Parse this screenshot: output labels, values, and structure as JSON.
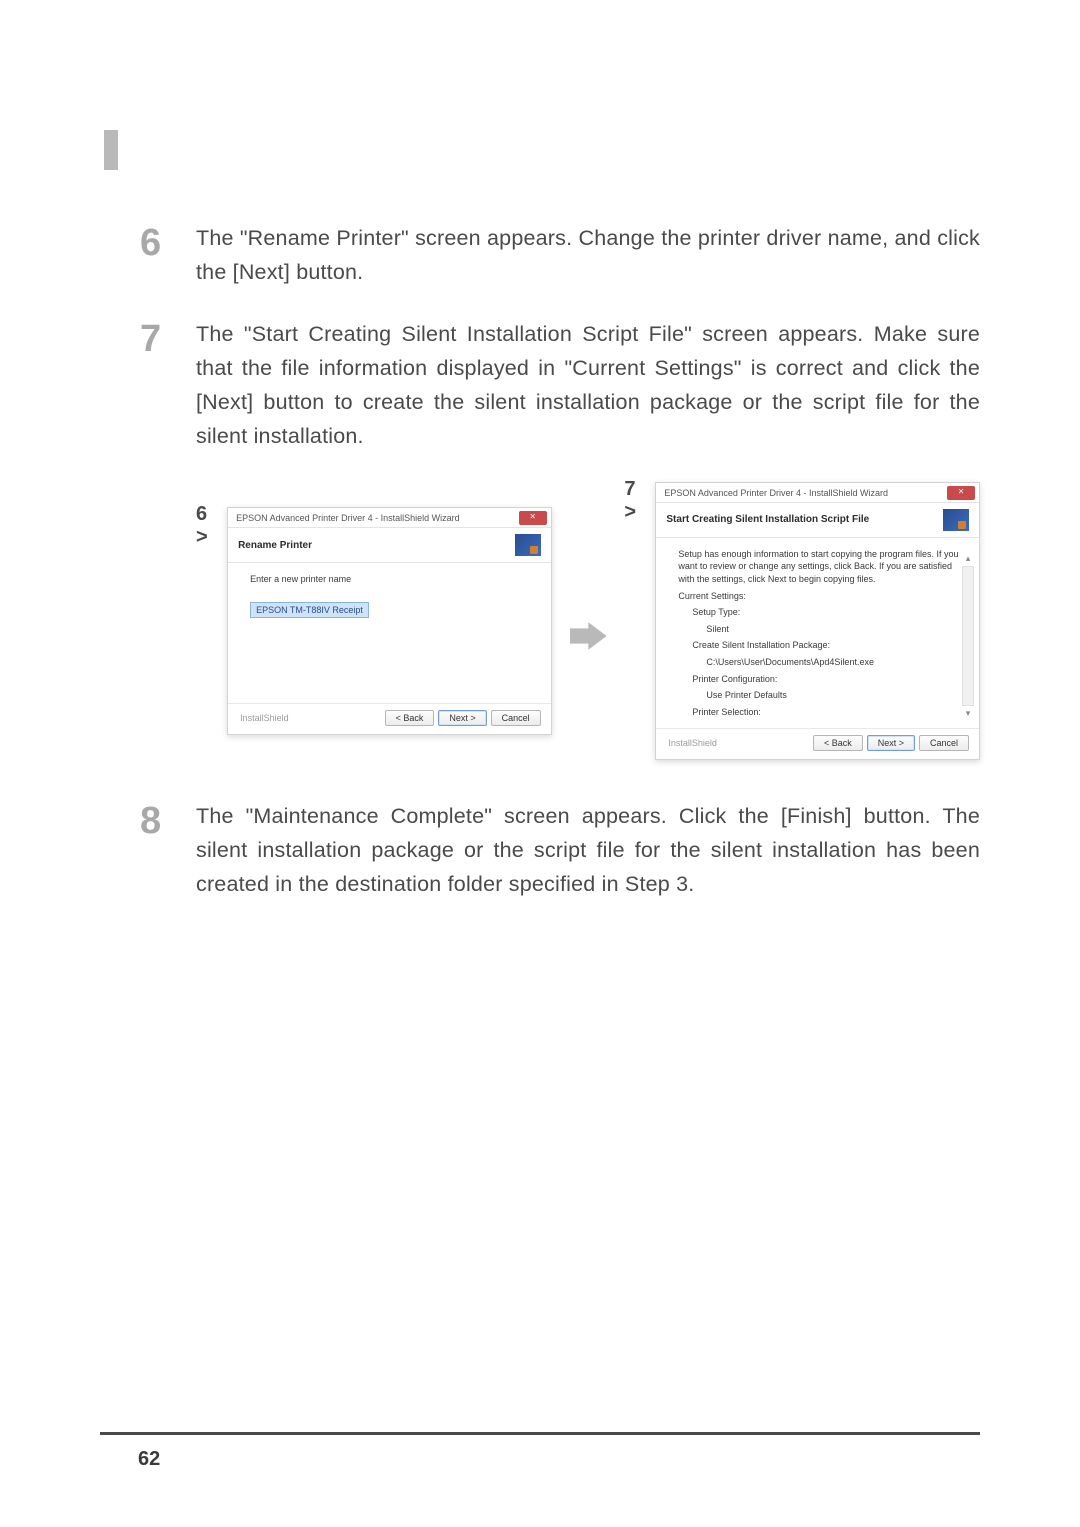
{
  "page": {
    "number": "62"
  },
  "steps": {
    "s6": {
      "num": "6",
      "text": "The \"Rename Printer\" screen appears. Change the printer driver name, and click the [Next] button."
    },
    "s7": {
      "num": "7",
      "text": "The \"Start Creating Silent Installation Script File\" screen appears. Make sure that the file information displayed in \"Current Settings\" is correct and click the [Next] button to create the silent installation package or the script file for the silent installation."
    },
    "s8": {
      "num": "8",
      "text": "The \"Maintenance Complete\" screen appears. Click the [Finish] button. The silent installation package or the script file for the silent installation has been created in the destination folder specified in Step 3."
    }
  },
  "figures": {
    "f6": {
      "label": "6 >"
    },
    "f7": {
      "label": "7 >"
    }
  },
  "dialog6": {
    "title": "EPSON Advanced Printer Driver 4 - InstallShield Wizard",
    "header": "Rename Printer",
    "label": "Enter a new printer name",
    "input": "EPSON TM-T88IV Receipt",
    "brand": "InstallShield",
    "buttons": {
      "back": "< Back",
      "next": "Next >",
      "cancel": "Cancel"
    }
  },
  "dialog7": {
    "title": "EPSON Advanced Printer Driver 4 - InstallShield Wizard",
    "header": "Start Creating Silent Installation Script File",
    "intro": "Setup has enough information to start copying the program files. If you want to review or change any settings, click Back. If you are satisfied with the settings, click Next to begin copying files.",
    "current": "Current Settings:",
    "lines": {
      "l1": "Setup Type:",
      "l1a": "Silent",
      "l2": "Create Silent Installation Package:",
      "l2a": "C:\\Users\\User\\Documents\\Apd4Silent.exe",
      "l3": "Printer Configuration:",
      "l3a": "Use Printer Defaults",
      "l4": "Printer Selection:"
    },
    "brand": "InstallShield",
    "buttons": {
      "back": "< Back",
      "next": "Next >",
      "cancel": "Cancel"
    }
  }
}
